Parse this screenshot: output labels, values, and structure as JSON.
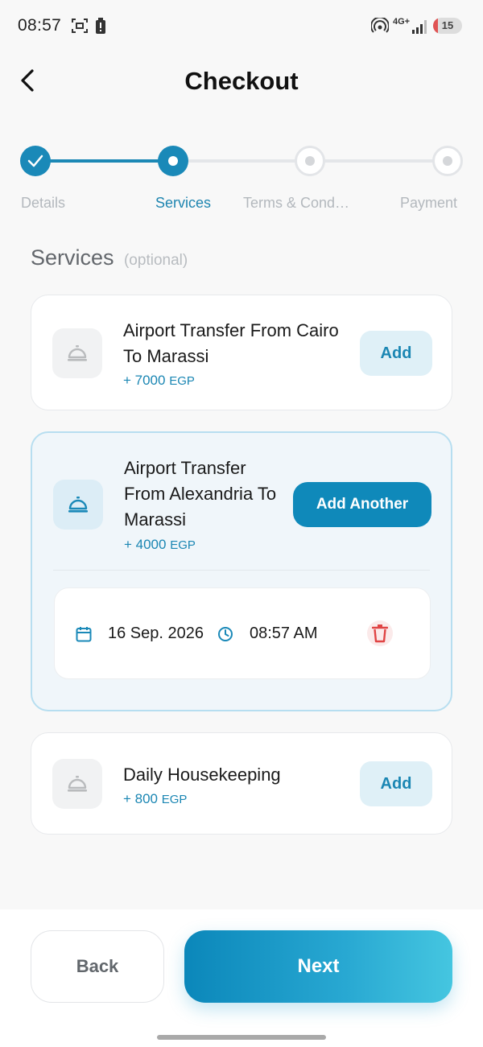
{
  "status_bar": {
    "time": "08:57",
    "network": "4G+",
    "battery": "15",
    "icons": [
      "screenshot-icon",
      "battery-alert-icon",
      "hotspot-icon",
      "signal-icon"
    ]
  },
  "header": {
    "title": "Checkout",
    "back_icon": "chevron-left-icon"
  },
  "stepper": {
    "steps": [
      {
        "label": "Details",
        "state": "done"
      },
      {
        "label": "Services",
        "state": "current"
      },
      {
        "label": "Terms & Cond…",
        "state": "todo"
      },
      {
        "label": "Payment",
        "state": "todo"
      }
    ]
  },
  "section": {
    "title": "Services",
    "subtitle": "(optional)"
  },
  "services": [
    {
      "title_line1": "Airport Transfer From Cairo",
      "title_line2": "To Marassi",
      "price": "+ 7000",
      "currency": "EGP",
      "action": "Add",
      "icon": "room-service-icon"
    },
    {
      "title_line1": "Airport Transfer",
      "title_line2": "From Alexandria To",
      "title_line3": "Marassi",
      "price": "+ 4000",
      "currency": "EGP",
      "action": "Add Another",
      "icon": "room-service-icon",
      "booking": {
        "date": "16 Sep. 2026",
        "time": "08:57 AM"
      }
    },
    {
      "title_line1": "Daily Housekeeping",
      "price": "+ 800",
      "currency": "EGP",
      "action": "Add",
      "icon": "room-service-icon"
    }
  ],
  "footer": {
    "back_label": "Back",
    "next_label": "Next"
  },
  "colors": {
    "accent": "#1a89b8",
    "next_gradient_start": "#0b87ba",
    "next_gradient_end": "#45c6e0",
    "danger": "#e04444"
  }
}
